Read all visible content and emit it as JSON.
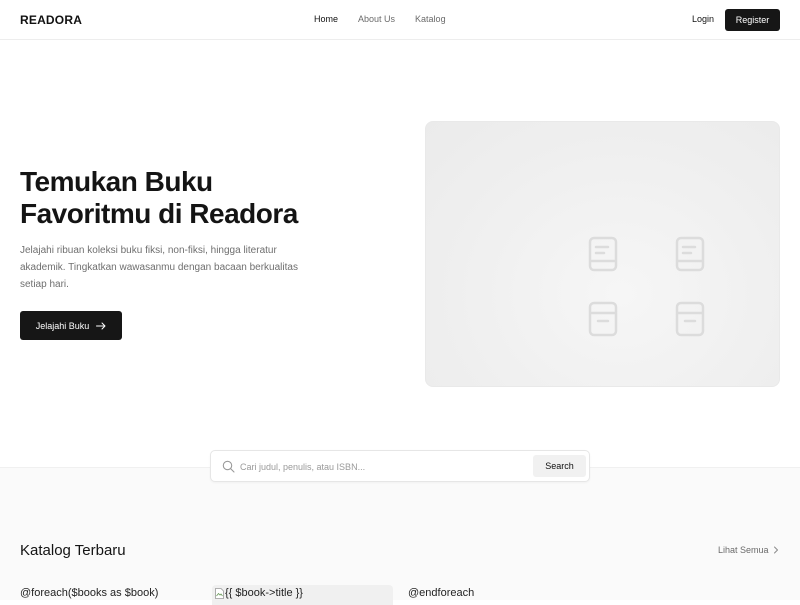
{
  "nav": {
    "brand": "READORA",
    "links": [
      "Home",
      "About Us",
      "Katalog"
    ],
    "login": "Login",
    "register": "Register"
  },
  "hero": {
    "title_line1": "Temukan Buku",
    "title_line2": "Favoritmu di Readora",
    "description": "Jelajahi ribuan koleksi buku fiksi, non-fiksi, hingga literatur akademik. Tingkatkan wawasanmu dengan bacaan berkualitas setiap hari.",
    "cta": "Jelajahi Buku"
  },
  "search": {
    "placeholder": "Cari judul, penulis, atau ISBN...",
    "button": "Search"
  },
  "catalog": {
    "title": "Katalog Terbaru",
    "see_all": "Lihat Semua",
    "raw_foreach": "@foreach($books as $book)",
    "broken_image_alt": "{{ $book->title }}",
    "raw_endforeach": "@endforeach"
  },
  "colors": {
    "primary": "#161616",
    "muted_text": "#6f6f6f",
    "section_bg": "#fafafa"
  },
  "icons": [
    "book-icon",
    "book-icon",
    "archive-icon",
    "archive-icon",
    "arrow-right-icon",
    "search-icon",
    "chevron-right-icon",
    "broken-image-icon"
  ]
}
